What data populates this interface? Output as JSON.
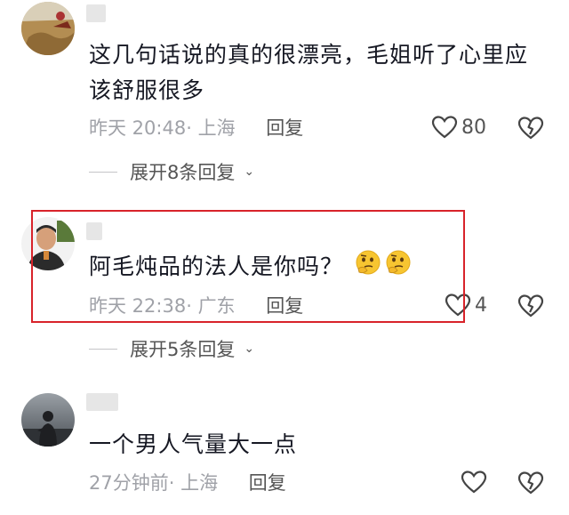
{
  "comments": [
    {
      "username": "■",
      "text": "这几句话说的真的很漂亮，毛姐听了心里应该舒服很多",
      "time": "昨天 20:48",
      "location": "上海",
      "reply_label": "回复",
      "likes": "80",
      "expand_label": "展开8条回复"
    },
    {
      "username": "■",
      "text": "阿毛炖品的法人是你吗？",
      "time": "昨天 22:38",
      "location": "广东",
      "reply_label": "回复",
      "likes": "4",
      "expand_label": "展开5条回复",
      "emojis": [
        "thinking-face-emoji",
        "thinking-face-emoji"
      ]
    },
    {
      "username": "■",
      "text": "一个男人气量大一点",
      "time": "27分钟前",
      "location": "上海",
      "reply_label": "回复",
      "likes": ""
    }
  ],
  "colors": {
    "highlight_border": "#d8232a",
    "meta_text": "#a0a2a8",
    "body_text": "#161823"
  }
}
